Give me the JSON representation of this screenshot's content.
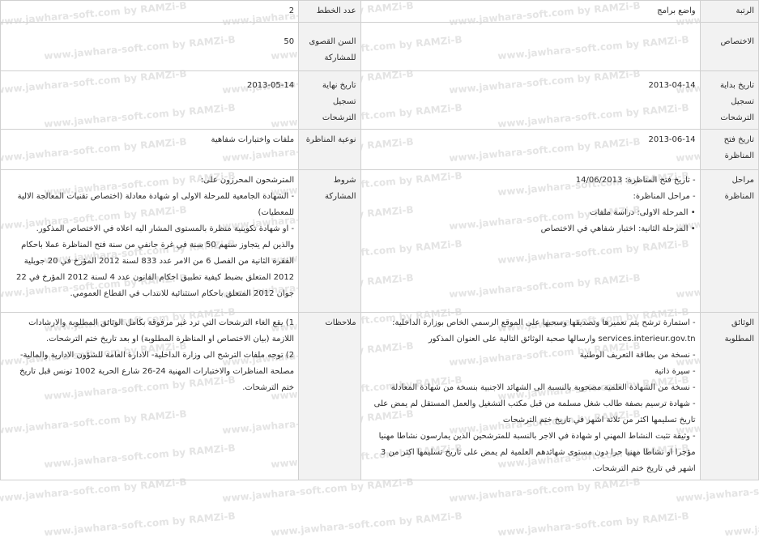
{
  "watermark": "www.jawhara-soft.com by RAMZi-B",
  "rows": {
    "r1": {
      "label_a": "الرتبة",
      "value_a": "واضع برامج",
      "label_b": "عدد الخطط",
      "value_b": "2"
    },
    "r2": {
      "label_a": "الاختصاص",
      "value_a": "",
      "label_b": "السن القصوى للمشاركة",
      "value_b": "50"
    },
    "r3": {
      "label_a": "تاريخ بداية تسجيل الترشحات",
      "value_a": "2013-04-14",
      "label_b": "تاريخ نهاية تسجيل الترشحات",
      "value_b": "2013-05-14"
    },
    "r4": {
      "label_a": "تاريخ فتح المناظرة",
      "value_a": "2013-06-14",
      "label_b": "نوعية المناظرة",
      "value_b": "ملفات واختبارات شفاهية"
    },
    "r5": {
      "label_a": "مراحل المناظرة",
      "stages": [
        "- تاريخ فتح المناظرة: 14/06/2013",
        "- مراحل المناظرة:",
        "• المرحلة الاولى: دراسة ملفات",
        "• المرحلة الثانية: اختبار شفاهي في الاختصاص"
      ],
      "label_b": "شروط المشاركة",
      "conditions": [
        "المترشحون المحرزون على:",
        "- الشهادة الجامعية للمرحلة الاولى او شهادة معادلة (اختصاص تقنيات المعالجة الالية للمعطيات)",
        "- او شهادة تكوينية منظرة بالمستوى المشار اليه اعلاه في الاختصاص المذكور.",
        "والذين لم يتجاوز سنهم 50 سنة في غرة جانفي من سنة فتح المناظرة عملا باحكام الفقرة الثانية من الفصل 6 من الامر عدد 833 لسنة 2012 المؤرخ في 20 جويلية 2012 المتعلق بضبط كيفية تطبيق احكام القانون عدد 4 لسنة 2012 المؤرخ في 22 جوان 2012 المتعلق باحكام استثنائية للانتداب في القطاع العمومي."
      ]
    },
    "r6": {
      "label_a": "الوثائق المطلوبة",
      "documents": [
        "- استمارة ترشح يتم تعميرها وتصديقها وسحبها على الموقع الرسمي الخاص بوزارة الداخلية: services.interieur.gov.tn وارسالها صحبة الوثائق التالية على العنوان المذكور",
        "- نسخة من بطاقة التعريف الوطنية",
        "- سيرة ذاتية",
        "- نسخة من الشهادة العلمية مصحوبة بالنسبة الى الشهائد الاجنبية بنسخة من شهادة المعادلة",
        "- شهادة ترسيم بصفة طالب شغل مسلمة من قبل مكتب التشغيل والعمل المستقل لم يمض على تاريخ تسليمها اكثر من ثلاثة اشهر في تاريخ ختم الترشحات",
        "- وثيقة تثبت النشاط المهني او شهادة في الاجر بالنسبة للمترشحين الذين يمارسون نشاطا مهنيا مؤجرا او نشاطا مهنيا حرا دون مستوى شهائدهم العلمية لم يمض على تاريخ تسليمها اكثر من 3 اشهر في تاريخ ختم الترشحات."
      ],
      "label_b": "ملاحظات",
      "notes": [
        "1) يقع الغاء الترشحات التي ترد غير مرفوقة بكامل الوثائق المطلوبة والارشادات اللازمة (بيان الاختصاص او المناظرة المطلوبة) او بعد تاريخ ختم الترشحات.",
        "2) توجه ملفات الترشح الى وزارة الداخلية- الادارة العامة للشؤون الادارية والمالية- مصلحة المناظرات والاختبارات المهنية 24-26 شارع الحرية 1002 تونس قبل تاريخ ختم الترشحات."
      ]
    }
  }
}
